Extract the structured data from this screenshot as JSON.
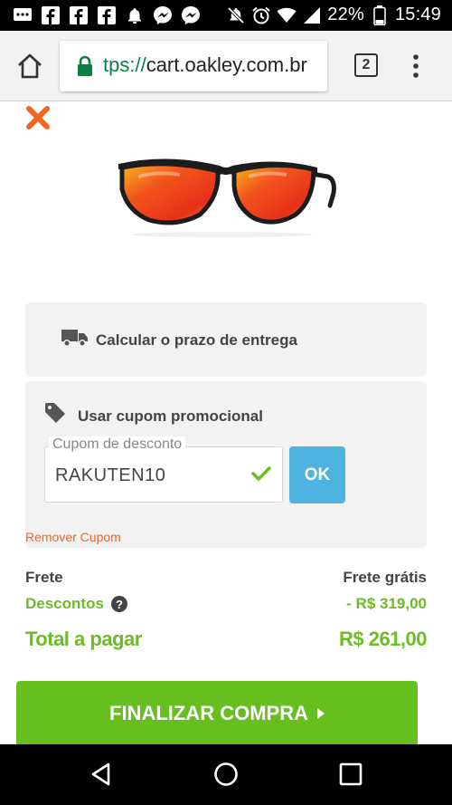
{
  "status_bar": {
    "battery_percent": "22%",
    "time": "15:49",
    "left_icons": [
      "messages-icon",
      "facebook-icon",
      "facebook-icon",
      "facebook-icon",
      "notification-icon",
      "messenger-icon",
      "messenger-icon"
    ],
    "right_icons": [
      "mute-icon",
      "alarm-icon",
      "wifi-icon",
      "signal-icon",
      "battery-icon"
    ]
  },
  "browser": {
    "url_scheme": "tps://",
    "url_host": "cart.oakley.com.br",
    "tab_count": "2"
  },
  "product": {
    "image_alt": "sunglasses"
  },
  "delivery": {
    "label": "Calcular o prazo de entrega"
  },
  "coupon": {
    "label": "Usar cupom promocional",
    "field_label": "Cupom de desconto",
    "value": "RAKUTEN10",
    "ok_label": "OK",
    "remove_label": "Remover Cupom"
  },
  "summary": {
    "shipping_label": "Frete",
    "shipping_value": "Frete grátis",
    "discount_label": "Descontos",
    "discount_value": "- R$ 319,00",
    "total_label": "Total a pagar",
    "total_value": "R$ 261,00",
    "help_glyph": "?"
  },
  "checkout": {
    "button_label": "FINALIZAR COMPRA"
  },
  "colors": {
    "accent_orange": "#f26522",
    "green": "#6dbb27",
    "button_green": "#66bf1f",
    "ok_blue": "#4db3e0"
  }
}
